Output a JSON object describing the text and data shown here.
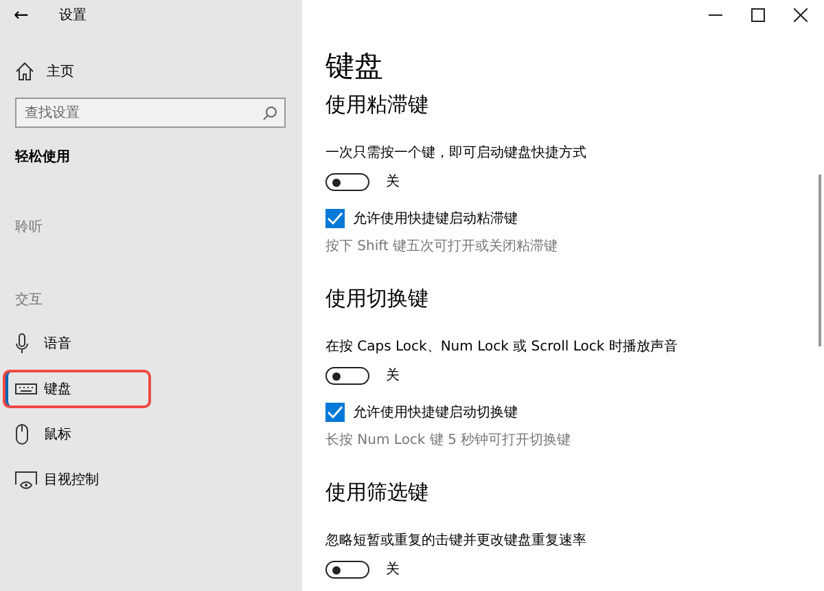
{
  "window": {
    "title": "设置",
    "back": "←"
  },
  "sidebar": {
    "home": "主页",
    "search": {
      "placeholder": "查找设置"
    },
    "category": "轻松使用",
    "groups": [
      {
        "label": "聆听"
      },
      {
        "label": "交互",
        "items": [
          {
            "label": "语音",
            "selected": false,
            "highlighted": false
          },
          {
            "label": "键盘",
            "selected": true,
            "highlighted": true
          },
          {
            "label": "鼠标",
            "selected": false,
            "highlighted": false
          },
          {
            "label": "目视控制",
            "selected": false,
            "highlighted": false
          }
        ]
      }
    ]
  },
  "page": {
    "title": "键盘",
    "sections": [
      {
        "heading": "使用粘滞键",
        "description": "一次只需按一个键，即可启动键盘快捷方式",
        "toggle": {
          "on": false,
          "label": "关"
        },
        "checkbox": {
          "checked": true,
          "label": "允许使用快捷键启动粘滞键"
        },
        "note": "按下 Shift 键五次可打开或关闭粘滞键"
      },
      {
        "heading": "使用切换键",
        "description": "在按 Caps Lock、Num Lock 或 Scroll Lock 时播放声音",
        "toggle": {
          "on": false,
          "label": "关"
        },
        "checkbox": {
          "checked": true,
          "label": "允许使用快捷键启动切换键"
        },
        "note": "长按 Num Lock 键 5 秒钟可打开切换键"
      },
      {
        "heading": "使用筛选键",
        "description": "忽略短暂或重复的击键并更改键盘重复速率",
        "toggle": {
          "on": false,
          "label": "关"
        }
      }
    ]
  }
}
